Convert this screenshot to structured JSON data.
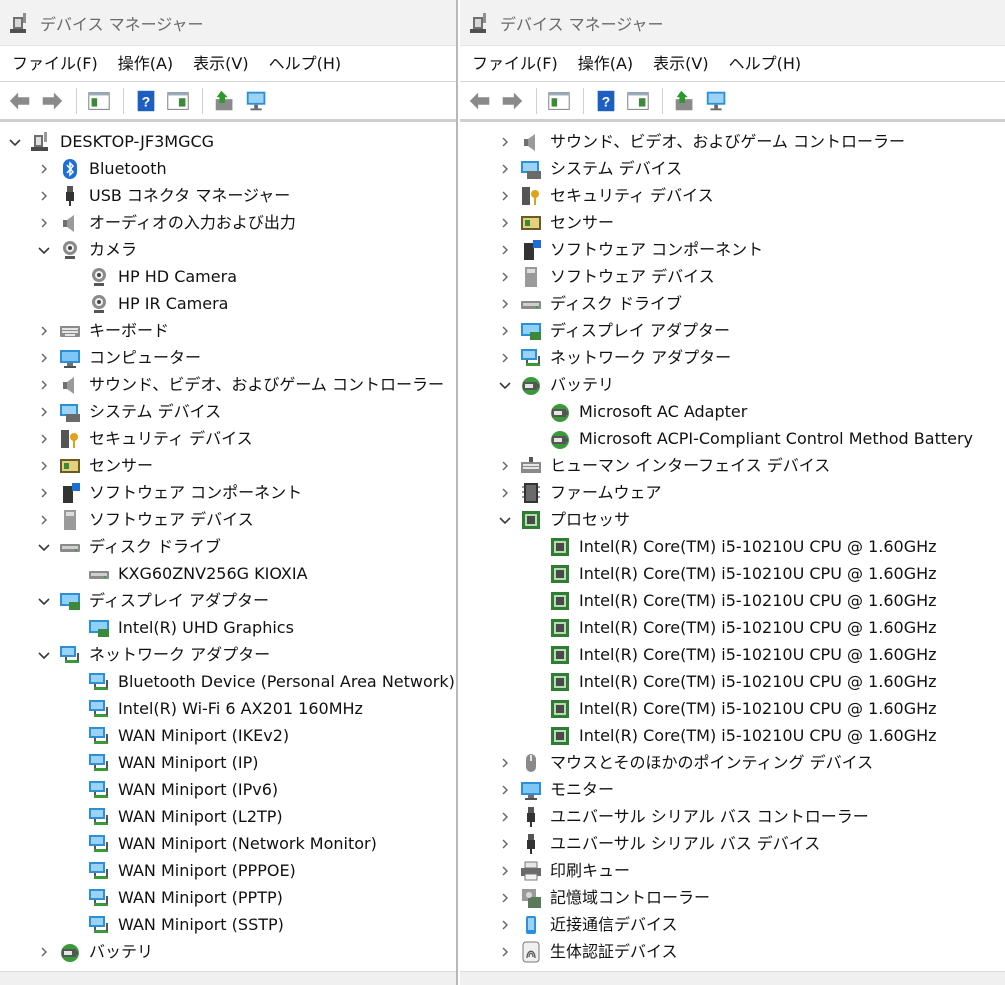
{
  "left": {
    "window_title": "デバイス マネージャー",
    "menu": [
      "ファイル(F)",
      "操作(A)",
      "表示(V)",
      "ヘルプ(H)"
    ],
    "tree": [
      {
        "label": "DESKTOP-JF3MGCG",
        "icon": "computer-root",
        "level": 0,
        "state": "expanded"
      },
      {
        "label": "Bluetooth",
        "icon": "bluetooth",
        "level": 1,
        "state": "collapsed"
      },
      {
        "label": "USB コネクタ マネージャー",
        "icon": "usb",
        "level": 1,
        "state": "collapsed"
      },
      {
        "label": "オーディオの入力および出力",
        "icon": "speaker",
        "level": 1,
        "state": "collapsed"
      },
      {
        "label": "カメラ",
        "icon": "camera",
        "level": 1,
        "state": "expanded"
      },
      {
        "label": "HP HD Camera",
        "icon": "camera",
        "level": 2,
        "state": "none"
      },
      {
        "label": "HP IR Camera",
        "icon": "camera",
        "level": 2,
        "state": "none"
      },
      {
        "label": "キーボード",
        "icon": "keyboard",
        "level": 1,
        "state": "collapsed"
      },
      {
        "label": "コンピューター",
        "icon": "monitor",
        "level": 1,
        "state": "collapsed"
      },
      {
        "label": "サウンド、ビデオ、およびゲーム コントローラー",
        "icon": "speaker",
        "level": 1,
        "state": "collapsed"
      },
      {
        "label": "システム デバイス",
        "icon": "system",
        "level": 1,
        "state": "collapsed"
      },
      {
        "label": "セキュリティ デバイス",
        "icon": "security",
        "level": 1,
        "state": "collapsed"
      },
      {
        "label": "センサー",
        "icon": "sensor",
        "level": 1,
        "state": "collapsed"
      },
      {
        "label": "ソフトウェア コンポーネント",
        "icon": "software-component",
        "level": 1,
        "state": "collapsed"
      },
      {
        "label": "ソフトウェア デバイス",
        "icon": "software-device",
        "level": 1,
        "state": "collapsed"
      },
      {
        "label": "ディスク ドライブ",
        "icon": "disk",
        "level": 1,
        "state": "expanded"
      },
      {
        "label": "KXG60ZNV256G KIOXIA",
        "icon": "disk",
        "level": 2,
        "state": "none"
      },
      {
        "label": "ディスプレイ アダプター",
        "icon": "display-adapter",
        "level": 1,
        "state": "expanded"
      },
      {
        "label": "Intel(R) UHD Graphics",
        "icon": "display-adapter",
        "level": 2,
        "state": "none"
      },
      {
        "label": "ネットワーク アダプター",
        "icon": "network",
        "level": 1,
        "state": "expanded"
      },
      {
        "label": "Bluetooth Device (Personal Area Network)",
        "icon": "network",
        "level": 2,
        "state": "none"
      },
      {
        "label": "Intel(R) Wi-Fi 6 AX201 160MHz",
        "icon": "network",
        "level": 2,
        "state": "none"
      },
      {
        "label": "WAN Miniport (IKEv2)",
        "icon": "network",
        "level": 2,
        "state": "none"
      },
      {
        "label": "WAN Miniport (IP)",
        "icon": "network",
        "level": 2,
        "state": "none"
      },
      {
        "label": "WAN Miniport (IPv6)",
        "icon": "network",
        "level": 2,
        "state": "none"
      },
      {
        "label": "WAN Miniport (L2TP)",
        "icon": "network",
        "level": 2,
        "state": "none"
      },
      {
        "label": "WAN Miniport (Network Monitor)",
        "icon": "network",
        "level": 2,
        "state": "none"
      },
      {
        "label": "WAN Miniport (PPPOE)",
        "icon": "network",
        "level": 2,
        "state": "none"
      },
      {
        "label": "WAN Miniport (PPTP)",
        "icon": "network",
        "level": 2,
        "state": "none"
      },
      {
        "label": "WAN Miniport (SSTP)",
        "icon": "network",
        "level": 2,
        "state": "none"
      },
      {
        "label": "バッテリ",
        "icon": "battery",
        "level": 1,
        "state": "collapsed"
      }
    ]
  },
  "right": {
    "window_title": "デバイス マネージャー",
    "menu": [
      "ファイル(F)",
      "操作(A)",
      "表示(V)",
      "ヘルプ(H)"
    ],
    "tree": [
      {
        "label": "サウンド、ビデオ、およびゲーム コントローラー",
        "icon": "speaker",
        "level": 1,
        "state": "collapsed"
      },
      {
        "label": "システム デバイス",
        "icon": "system",
        "level": 1,
        "state": "collapsed"
      },
      {
        "label": "セキュリティ デバイス",
        "icon": "security",
        "level": 1,
        "state": "collapsed"
      },
      {
        "label": "センサー",
        "icon": "sensor",
        "level": 1,
        "state": "collapsed"
      },
      {
        "label": "ソフトウェア コンポーネント",
        "icon": "software-component",
        "level": 1,
        "state": "collapsed"
      },
      {
        "label": "ソフトウェア デバイス",
        "icon": "software-device",
        "level": 1,
        "state": "collapsed"
      },
      {
        "label": "ディスク ドライブ",
        "icon": "disk",
        "level": 1,
        "state": "collapsed"
      },
      {
        "label": "ディスプレイ アダプター",
        "icon": "display-adapter",
        "level": 1,
        "state": "collapsed"
      },
      {
        "label": "ネットワーク アダプター",
        "icon": "network",
        "level": 1,
        "state": "collapsed"
      },
      {
        "label": "バッテリ",
        "icon": "battery",
        "level": 1,
        "state": "expanded"
      },
      {
        "label": "Microsoft AC Adapter",
        "icon": "battery",
        "level": 2,
        "state": "none"
      },
      {
        "label": "Microsoft ACPI-Compliant Control Method Battery",
        "icon": "battery",
        "level": 2,
        "state": "none"
      },
      {
        "label": "ヒューマン インターフェイス デバイス",
        "icon": "hid",
        "level": 1,
        "state": "collapsed"
      },
      {
        "label": "ファームウェア",
        "icon": "firmware",
        "level": 1,
        "state": "collapsed"
      },
      {
        "label": "プロセッサ",
        "icon": "processor",
        "level": 1,
        "state": "expanded"
      },
      {
        "label": "Intel(R) Core(TM) i5-10210U CPU @ 1.60GHz",
        "icon": "processor",
        "level": 2,
        "state": "none"
      },
      {
        "label": "Intel(R) Core(TM) i5-10210U CPU @ 1.60GHz",
        "icon": "processor",
        "level": 2,
        "state": "none"
      },
      {
        "label": "Intel(R) Core(TM) i5-10210U CPU @ 1.60GHz",
        "icon": "processor",
        "level": 2,
        "state": "none"
      },
      {
        "label": "Intel(R) Core(TM) i5-10210U CPU @ 1.60GHz",
        "icon": "processor",
        "level": 2,
        "state": "none"
      },
      {
        "label": "Intel(R) Core(TM) i5-10210U CPU @ 1.60GHz",
        "icon": "processor",
        "level": 2,
        "state": "none"
      },
      {
        "label": "Intel(R) Core(TM) i5-10210U CPU @ 1.60GHz",
        "icon": "processor",
        "level": 2,
        "state": "none"
      },
      {
        "label": "Intel(R) Core(TM) i5-10210U CPU @ 1.60GHz",
        "icon": "processor",
        "level": 2,
        "state": "none"
      },
      {
        "label": "Intel(R) Core(TM) i5-10210U CPU @ 1.60GHz",
        "icon": "processor",
        "level": 2,
        "state": "none"
      },
      {
        "label": "マウスとそのほかのポインティング デバイス",
        "icon": "mouse",
        "level": 1,
        "state": "collapsed"
      },
      {
        "label": "モニター",
        "icon": "monitor",
        "level": 1,
        "state": "collapsed"
      },
      {
        "label": "ユニバーサル シリアル バス コントローラー",
        "icon": "usb",
        "level": 1,
        "state": "collapsed"
      },
      {
        "label": "ユニバーサル シリアル バス デバイス",
        "icon": "usb",
        "level": 1,
        "state": "collapsed"
      },
      {
        "label": "印刷キュー",
        "icon": "printer",
        "level": 1,
        "state": "collapsed"
      },
      {
        "label": "記憶域コントローラー",
        "icon": "storage-controller",
        "level": 1,
        "state": "collapsed"
      },
      {
        "label": "近接通信デバイス",
        "icon": "proximity",
        "level": 1,
        "state": "collapsed"
      },
      {
        "label": "生体認証デバイス",
        "icon": "biometric",
        "level": 1,
        "state": "collapsed"
      }
    ]
  },
  "toolbar_icons": [
    "back-arrow-icon",
    "forward-arrow-icon",
    "show-hide-console-tree-icon",
    "help-icon",
    "properties-icon",
    "update-driver-icon",
    "scan-hardware-icon"
  ],
  "colors": {
    "accent_blue": "#1f6fd0",
    "titlebar_bg": "#f2f2f2",
    "chevron": "#6b6b6b",
    "chip_green": "#2e7d32"
  }
}
